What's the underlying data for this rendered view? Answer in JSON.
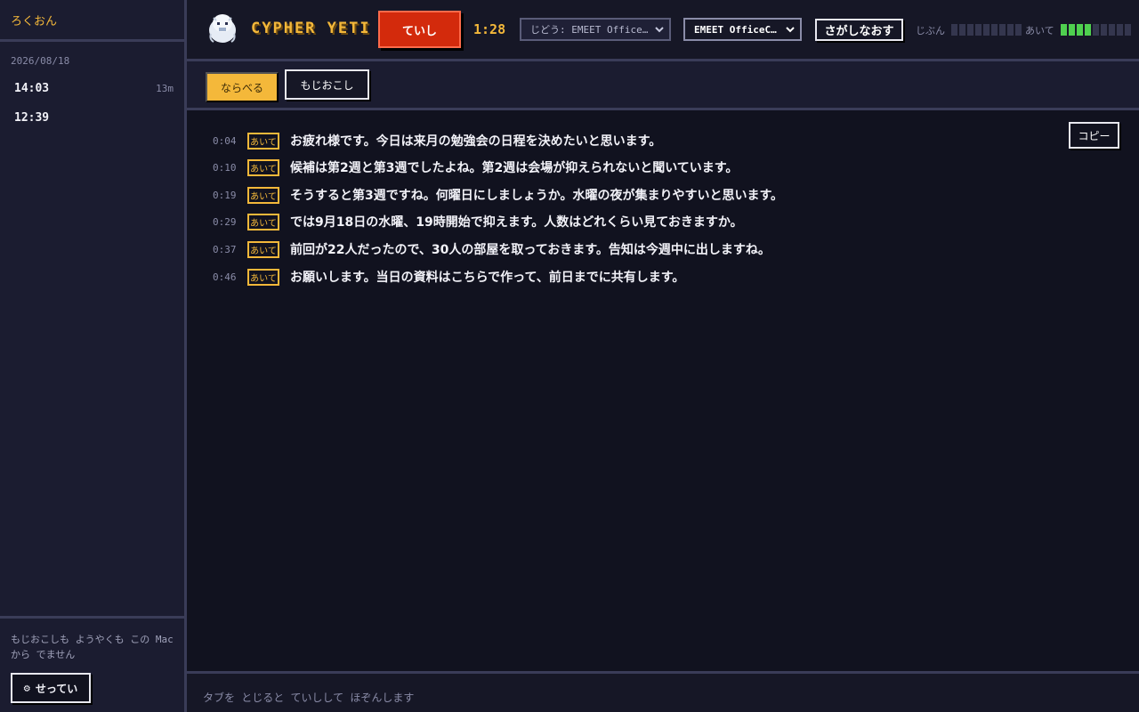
{
  "sidebar": {
    "title": "ろくおん",
    "date": "2026/08/18",
    "sessions": [
      {
        "time": "14:03",
        "duration": "13m"
      },
      {
        "time": "12:39",
        "duration": ""
      }
    ],
    "footer_note": "もじおこしも ようやくも この Mac から でません",
    "settings_icon": "gear-icon",
    "settings_label": "せってい"
  },
  "header": {
    "brand": "CYPHER YETI",
    "stop_label": "ていし",
    "elapsed": "1:28",
    "auto_device": "じどう: EMEET Office…",
    "device": "EMEET OfficeC…",
    "rescan_label": "さがしなおす",
    "my_meter_label": "じぶん",
    "my_level": 0,
    "other_meter_label": "あいて",
    "other_level": 0.44,
    "accent_color": "#f4b83a",
    "stop_color": "#d32a0c",
    "meter_color": "#4fd04f"
  },
  "toolbar": {
    "tab_arrange": "ならべる",
    "tab_transcript": "もじおこし"
  },
  "main": {
    "copy_label": "コピー",
    "lines": [
      {
        "ts": "0:04",
        "speaker": "あいて",
        "text": "お疲れ様です。今日は来月の勉強会の日程を決めたいと思います。"
      },
      {
        "ts": "0:10",
        "speaker": "あいて",
        "text": "候補は第2週と第3週でしたよね。第2週は会場が抑えられないと聞いています。"
      },
      {
        "ts": "0:19",
        "speaker": "あいて",
        "text": "そうすると第3週ですね。何曜日にしましょうか。水曜の夜が集まりやすいと思います。"
      },
      {
        "ts": "0:29",
        "speaker": "あいて",
        "text": "では9月18日の水曜、19時開始で抑えます。人数はどれくらい見ておきますか。"
      },
      {
        "ts": "0:37",
        "speaker": "あいて",
        "text": "前回が22人だったので、30人の部屋を取っておきます。告知は今週中に出しますね。"
      },
      {
        "ts": "0:46",
        "speaker": "あいて",
        "text": "お願いします。当日の資料はこちらで作って、前日までに共有します。"
      }
    ]
  },
  "statusbar": {
    "message": "タブを とじると ていしして ほぞんします"
  }
}
